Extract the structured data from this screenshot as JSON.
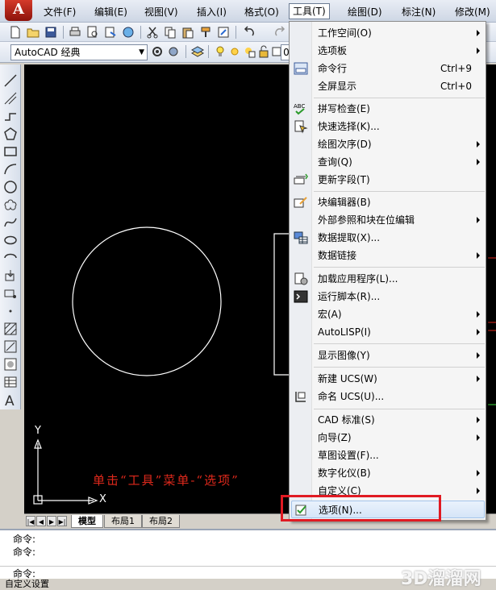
{
  "menubar": {
    "items": [
      "文件(F)",
      "编辑(E)",
      "视图(V)",
      "插入(I)",
      "格式(O)",
      "工具(T)",
      "绘图(D)",
      "标注(N)",
      "修改(M)"
    ],
    "active": "工具(T)"
  },
  "toolbar": {
    "workspace": "AutoCAD 经典",
    "layer": "0"
  },
  "tools_menu": {
    "items": [
      {
        "label": "工作空间(O)",
        "submenu": true
      },
      {
        "label": "选项板",
        "submenu": true
      },
      {
        "label": "命令行",
        "shortcut": "Ctrl+9",
        "icon": "command-line-icon"
      },
      {
        "label": "全屏显示",
        "shortcut": "Ctrl+0"
      },
      {
        "label": "拼写检查(E)",
        "icon": "spell-check-icon"
      },
      {
        "label": "快速选择(K)...",
        "icon": "quick-select-icon"
      },
      {
        "label": "绘图次序(D)",
        "submenu": true
      },
      {
        "label": "查询(Q)",
        "submenu": true
      },
      {
        "label": "更新字段(T)",
        "icon": "update-field-icon"
      },
      {
        "label": "块编辑器(B)",
        "icon": "block-editor-icon"
      },
      {
        "label": "外部参照和块在位编辑",
        "submenu": true
      },
      {
        "label": "数据提取(X)...",
        "icon": "data-extraction-icon"
      },
      {
        "label": "数据链接",
        "submenu": true
      },
      {
        "label": "加载应用程序(L)...",
        "icon": "load-application-icon"
      },
      {
        "label": "运行脚本(R)...",
        "icon": "run-script-icon"
      },
      {
        "label": "宏(A)",
        "submenu": true
      },
      {
        "label": "AutoLISP(I)",
        "submenu": true
      },
      {
        "label": "显示图像(Y)",
        "submenu": true
      },
      {
        "label": "新建 UCS(W)",
        "submenu": true
      },
      {
        "label": "命名 UCS(U)...",
        "icon": "named-ucs-icon"
      },
      {
        "label": "CAD 标准(S)",
        "submenu": true
      },
      {
        "label": "向导(Z)",
        "submenu": true
      },
      {
        "label": "草图设置(F)..."
      },
      {
        "label": "数字化仪(B)",
        "submenu": true
      },
      {
        "label": "自定义(C)",
        "submenu": true
      },
      {
        "label": "选项(N)...",
        "icon": "options-check-icon",
        "highlighted": true
      }
    ]
  },
  "canvas": {
    "annotation": "单击“工具”菜单-“选项”",
    "ucs_x": "X",
    "ucs_y": "Y"
  },
  "layout_tabs": [
    "模型",
    "布局1",
    "布局2"
  ],
  "command": {
    "lines": [
      "命令:",
      "命令:"
    ],
    "prompt": "命令:"
  },
  "statusbar": {
    "text": "自定义设置"
  },
  "watermark": "3D溜溜网",
  "colors": {
    "canvas": "#000000",
    "highlight_box": "#e01a22",
    "annotation": "#e0291c"
  }
}
